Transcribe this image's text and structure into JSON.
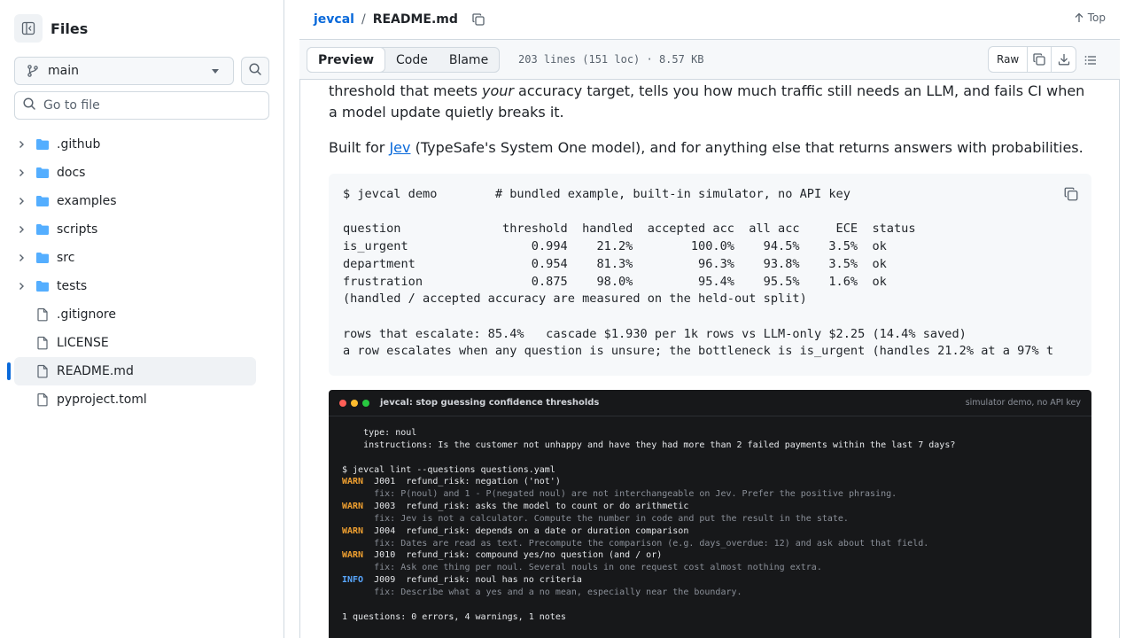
{
  "sidebar": {
    "title": "Files",
    "branch": "main",
    "goto_placeholder": "Go to file",
    "items": [
      {
        "type": "folder",
        "name": ".github"
      },
      {
        "type": "folder",
        "name": "docs"
      },
      {
        "type": "folder",
        "name": "examples"
      },
      {
        "type": "folder",
        "name": "scripts"
      },
      {
        "type": "folder",
        "name": "src"
      },
      {
        "type": "folder",
        "name": "tests"
      },
      {
        "type": "file",
        "name": ".gitignore"
      },
      {
        "type": "file",
        "name": "LICENSE"
      },
      {
        "type": "file",
        "name": "README.md",
        "active": true
      },
      {
        "type": "file",
        "name": "pyproject.toml"
      }
    ]
  },
  "header": {
    "repo": "jevcal",
    "separator": "/",
    "file": "README.md",
    "top_label": "Top"
  },
  "toolbar": {
    "tabs": [
      "Preview",
      "Code",
      "Blame"
    ],
    "selected_tab": "Preview",
    "meta": "203 lines (151 loc) · 8.57 KB",
    "raw_label": "Raw"
  },
  "readme": {
    "p1_a": "threshold that meets ",
    "p1_em": "your",
    "p1_b": " accuracy target, tells you how much traffic still needs an LLM, and fails CI when a model update quietly breaks it.",
    "p2_a": "Built for ",
    "p2_link": "Jev",
    "p2_b": " (TypeSafe's System One model), and for anything else that returns answers with probabilities.",
    "code": "$ jevcal demo        # bundled example, built-in simulator, no API key\n\nquestion              threshold  handled  accepted acc  all acc     ECE  status\nis_urgent                 0.994    21.2%        100.0%    94.5%    3.5%  ok\ndepartment                0.954    81.3%         96.3%    93.8%    3.5%  ok\nfrustration               0.875    98.0%         95.4%    95.5%    1.6%  ok\n(handled / accepted accuracy are measured on the held-out split)\n\nrows that escalate: 85.4%   cascade $1.930 per 1k rows vs LLM-only $2.25 (14.4% saved)\na row escalates when any question is unsure; the bottleneck is is_urgent (handles 21.2% at a 97% t"
  },
  "terminal": {
    "title": "jevcal: stop guessing confidence thresholds",
    "subtitle": "simulator demo, no API key",
    "dot_colors": [
      "#ff5f57",
      "#febc2e",
      "#28c840"
    ],
    "lines": [
      {
        "kind": "plain",
        "text": "    type: noul"
      },
      {
        "kind": "plain",
        "text": "    instructions: Is the customer not unhappy and have they had more than 2 failed payments within the last 7 days?"
      },
      {
        "kind": "plain",
        "text": " "
      },
      {
        "kind": "plain",
        "text": "$ jevcal lint --questions questions.yaml"
      },
      {
        "kind": "warn",
        "tag": "WARN",
        "text": "  J001  refund_risk: negation ('not')"
      },
      {
        "kind": "fix",
        "text": "      fix: P(noul) and 1 - P(negated noul) are not interchangeable on Jev. Prefer the positive phrasing."
      },
      {
        "kind": "warn",
        "tag": "WARN",
        "text": "  J003  refund_risk: asks the model to count or do arithmetic"
      },
      {
        "kind": "fix",
        "text": "      fix: Jev is not a calculator. Compute the number in code and put the result in the state."
      },
      {
        "kind": "warn",
        "tag": "WARN",
        "text": "  J004  refund_risk: depends on a date or duration comparison"
      },
      {
        "kind": "fix",
        "text": "      fix: Dates are read as text. Precompute the comparison (e.g. days_overdue: 12) and ask about that field."
      },
      {
        "kind": "warn",
        "tag": "WARN",
        "text": "  J010  refund_risk: compound yes/no question (and / or)"
      },
      {
        "kind": "fix",
        "text": "      fix: Ask one thing per noul. Several nouls in one request cost almost nothing extra."
      },
      {
        "kind": "info",
        "tag": "INFO",
        "text": "  J009  refund_risk: noul has no criteria"
      },
      {
        "kind": "fix",
        "text": "      fix: Describe what a yes and a no mean, especially near the boundary."
      },
      {
        "kind": "plain",
        "text": " "
      },
      {
        "kind": "plain",
        "text": "1 questions: 0 errors, 4 warnings, 1 notes"
      }
    ]
  },
  "colors": {
    "accent": "#0969da",
    "warn": "#f0a030",
    "info": "#58a6ff",
    "terminal_bg": "#17181a"
  },
  "icons": {
    "sidebar_toggle": "sidebar-collapse-icon",
    "branch": "git-branch-icon",
    "search": "search-icon",
    "folder": "folder-icon",
    "file": "file-icon",
    "chevron": "chevron-right-icon",
    "copy": "copy-icon",
    "download": "download-icon",
    "outline": "list-icon",
    "top": "arrow-up-icon"
  }
}
